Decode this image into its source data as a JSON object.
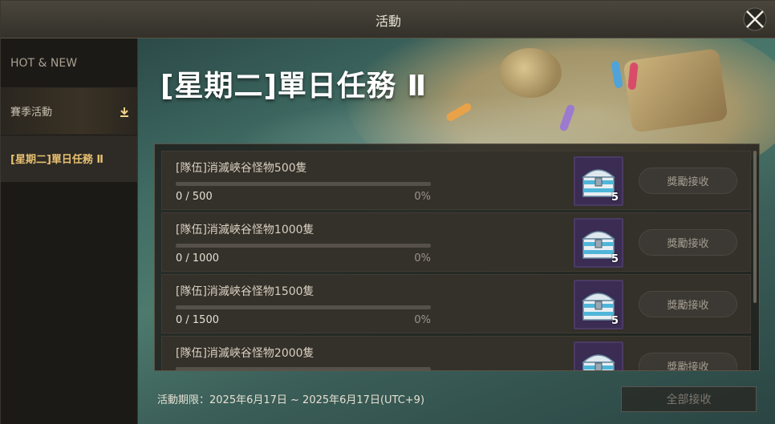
{
  "window": {
    "title": "活動"
  },
  "sidebar": {
    "items": [
      {
        "label": "HOT & NEW"
      },
      {
        "label": "賽季活動"
      },
      {
        "label": "[星期二]單日任務 Ⅱ"
      }
    ]
  },
  "main": {
    "title": "[星期二]單日任務 Ⅱ",
    "missions": [
      {
        "name": "[隊伍]消滅峽谷怪物500隻",
        "progress": "0 / 500",
        "percent": "0%",
        "progress_fraction": 0,
        "reward_qty": "5",
        "claim_label": "獎勵接收"
      },
      {
        "name": "[隊伍]消滅峽谷怪物1000隻",
        "progress": "0 / 1000",
        "percent": "0%",
        "progress_fraction": 0,
        "reward_qty": "5",
        "claim_label": "獎勵接收"
      },
      {
        "name": "[隊伍]消滅峽谷怪物1500隻",
        "progress": "0 / 1500",
        "percent": "0%",
        "progress_fraction": 0,
        "reward_qty": "5",
        "claim_label": "獎勵接收"
      },
      {
        "name": "[隊伍]消滅峽谷怪物2000隻",
        "progress": "",
        "percent": "",
        "progress_fraction": 0,
        "reward_qty": "",
        "claim_label": "獎勵接收"
      }
    ],
    "period": "活動期限：2025年6月17日 ~ 2025年6月17日(UTC+9)",
    "claim_all_label": "全部接收"
  },
  "icons": {
    "close": "close-icon",
    "season_badge": "download-arrow-icon",
    "reward": "treasure-chest-icon"
  },
  "colors": {
    "selected_sidebar_text": "#e8c070",
    "progress_fill": "#d0a850",
    "chest_frame": "#4a3b63"
  }
}
